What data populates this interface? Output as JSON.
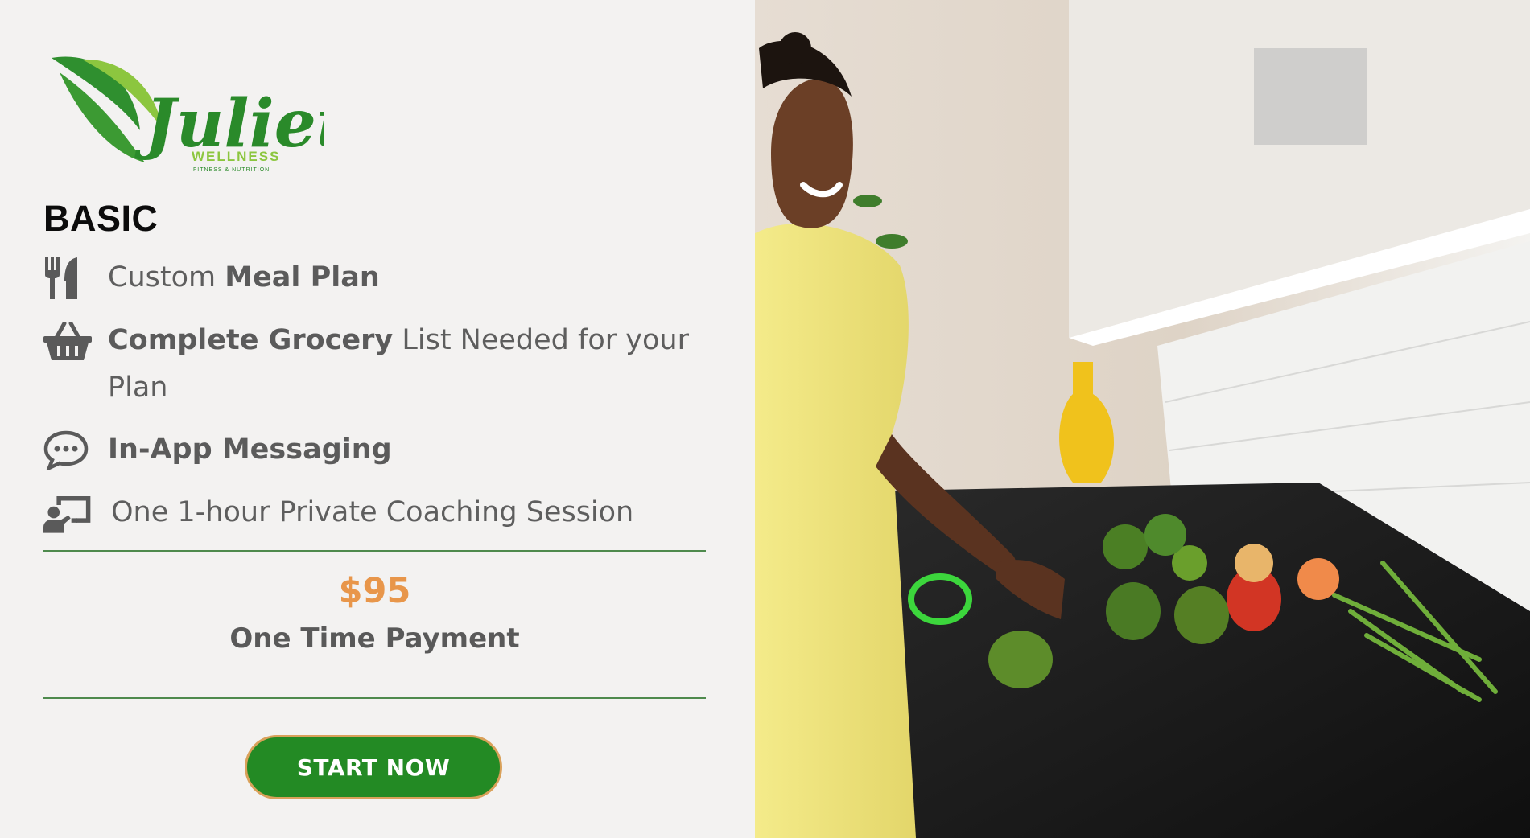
{
  "brand": {
    "logo_name": "Juliet",
    "logo_sub": "WELLNESS",
    "logo_tag": "FITNESS & NUTRITION"
  },
  "plan": {
    "title": "BASIC",
    "features": [
      {
        "icon": "utensils-icon",
        "pre": "Custom ",
        "bold": "Meal Plan",
        "post": ""
      },
      {
        "icon": "basket-icon",
        "pre": "",
        "bold": "Complete Grocery",
        "post": " List Needed for your",
        "line2": "Plan"
      },
      {
        "icon": "chat-bubble-icon",
        "pre": "",
        "bold": "In-App Messaging",
        "post": ""
      },
      {
        "icon": "chalkboard-teacher-icon",
        "pre": "One 1-hour Private Coaching Session",
        "bold": "",
        "post": ""
      }
    ],
    "price": "$95",
    "payment_note": "One Time Payment",
    "cta_label": "START NOW"
  },
  "colors": {
    "accent_green": "#238a24",
    "price_orange": "#e8964a",
    "divider": "#4e8a4d",
    "button_border": "#d9a15a"
  }
}
